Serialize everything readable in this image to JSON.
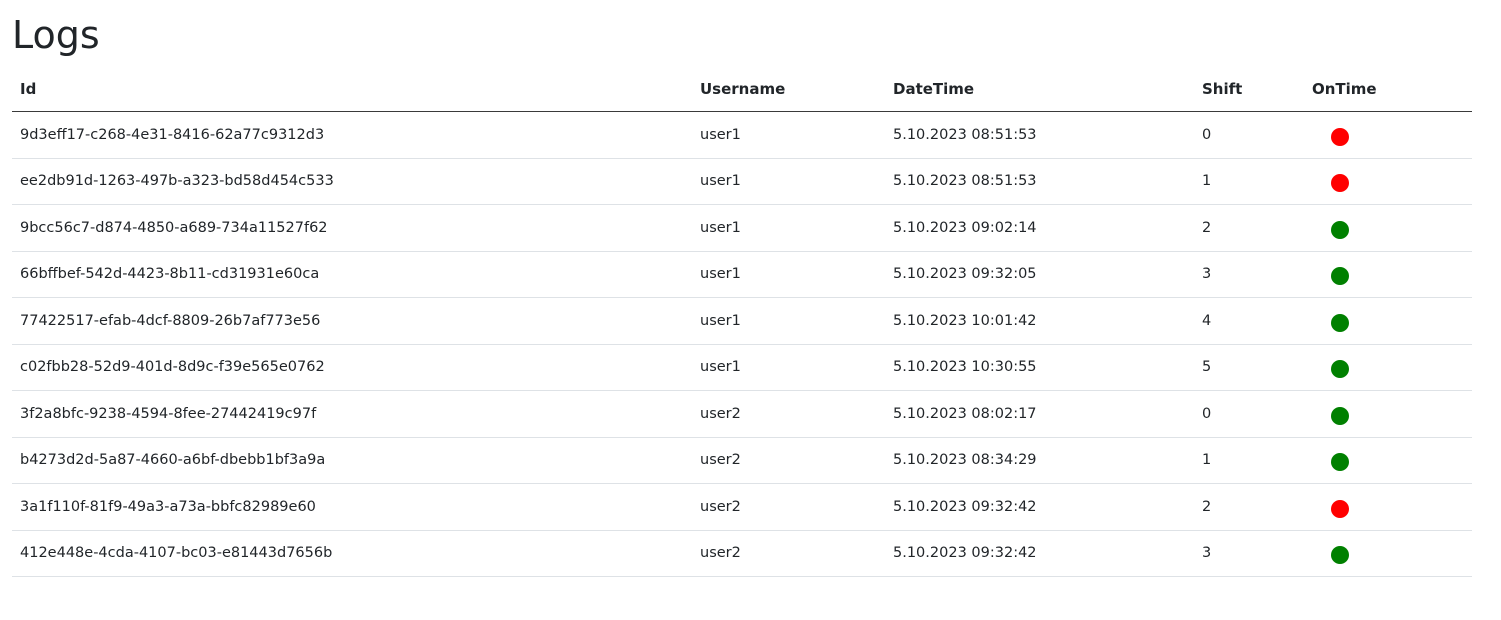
{
  "page": {
    "title": "Logs"
  },
  "table": {
    "headers": {
      "id": "Id",
      "username": "Username",
      "datetime": "DateTime",
      "shift": "Shift",
      "ontime": "OnTime"
    },
    "rows": [
      {
        "id": "9d3eff17-c268-4e31-8416-62a77c9312d3",
        "username": "user1",
        "datetime": "5.10.2023 08:51:53",
        "shift": "0",
        "ontime": false
      },
      {
        "id": "ee2db91d-1263-497b-a323-bd58d454c533",
        "username": "user1",
        "datetime": "5.10.2023 08:51:53",
        "shift": "1",
        "ontime": false
      },
      {
        "id": "9bcc56c7-d874-4850-a689-734a11527f62",
        "username": "user1",
        "datetime": "5.10.2023 09:02:14",
        "shift": "2",
        "ontime": true
      },
      {
        "id": "66bffbef-542d-4423-8b11-cd31931e60ca",
        "username": "user1",
        "datetime": "5.10.2023 09:32:05",
        "shift": "3",
        "ontime": true
      },
      {
        "id": "77422517-efab-4dcf-8809-26b7af773e56",
        "username": "user1",
        "datetime": "5.10.2023 10:01:42",
        "shift": "4",
        "ontime": true
      },
      {
        "id": "c02fbb28-52d9-401d-8d9c-f39e565e0762",
        "username": "user1",
        "datetime": "5.10.2023 10:30:55",
        "shift": "5",
        "ontime": true
      },
      {
        "id": "3f2a8bfc-9238-4594-8fee-27442419c97f",
        "username": "user2",
        "datetime": "5.10.2023 08:02:17",
        "shift": "0",
        "ontime": true
      },
      {
        "id": "b4273d2d-5a87-4660-a6bf-dbebb1bf3a9a",
        "username": "user2",
        "datetime": "5.10.2023 08:34:29",
        "shift": "1",
        "ontime": true
      },
      {
        "id": "3a1f110f-81f9-49a3-a73a-bbfc82989e60",
        "username": "user2",
        "datetime": "5.10.2023 09:32:42",
        "shift": "2",
        "ontime": false
      },
      {
        "id": "412e448e-4cda-4107-bc03-e81443d7656b",
        "username": "user2",
        "datetime": "5.10.2023 09:32:42",
        "shift": "3",
        "ontime": true
      }
    ]
  },
  "colors": {
    "on_time": "#008000",
    "late": "#ff0000",
    "text": "#212529",
    "row_border": "#dee2e6"
  },
  "icons": {
    "on_time": "green-status-dot-icon",
    "late": "red-status-dot-icon"
  }
}
